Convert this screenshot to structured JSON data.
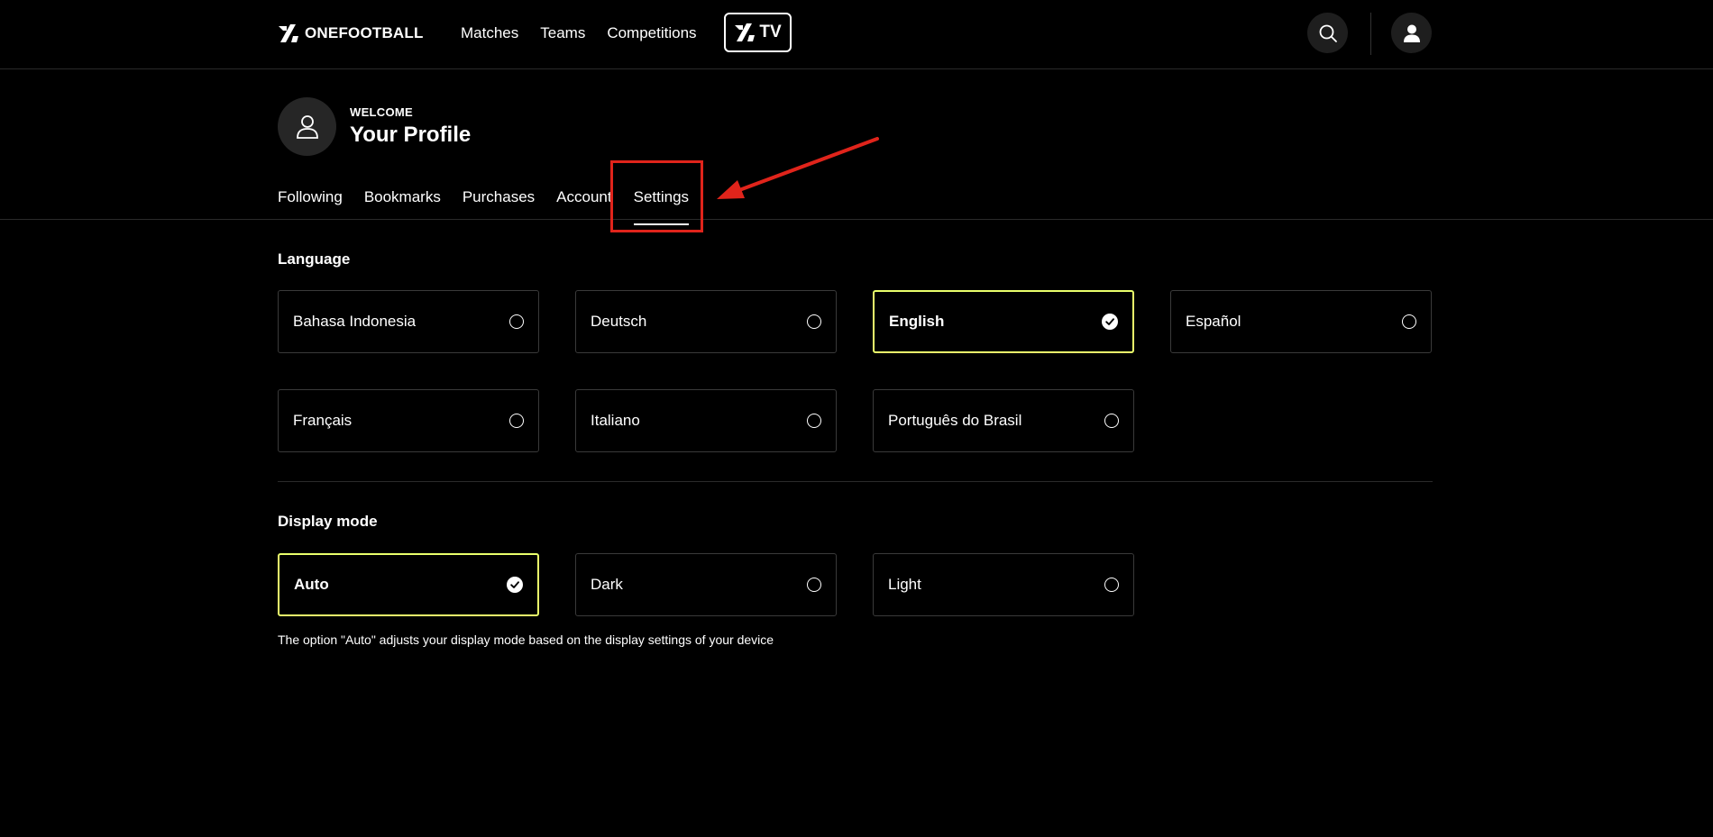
{
  "brand": {
    "name": "ONEFOOTBALL"
  },
  "nav": {
    "items": [
      {
        "label": "Matches"
      },
      {
        "label": "Teams"
      },
      {
        "label": "Competitions"
      }
    ],
    "tv_label": "TV"
  },
  "profile": {
    "welcome": "WELCOME",
    "title": "Your Profile"
  },
  "tabs": [
    {
      "label": "Following"
    },
    {
      "label": "Bookmarks"
    },
    {
      "label": "Purchases"
    },
    {
      "label": "Account"
    },
    {
      "label": "Settings",
      "active": true
    }
  ],
  "language": {
    "title": "Language",
    "options": [
      {
        "label": "Bahasa Indonesia",
        "selected": false
      },
      {
        "label": "Deutsch",
        "selected": false
      },
      {
        "label": "English",
        "selected": true
      },
      {
        "label": "Español",
        "selected": false
      },
      {
        "label": "Français",
        "selected": false
      },
      {
        "label": "Italiano",
        "selected": false
      },
      {
        "label": "Português do Brasil",
        "selected": false
      }
    ]
  },
  "display_mode": {
    "title": "Display mode",
    "options": [
      {
        "label": "Auto",
        "selected": true
      },
      {
        "label": "Dark",
        "selected": false
      },
      {
        "label": "Light",
        "selected": false
      }
    ],
    "note": "The option \"Auto\" adjusts your display mode based on the display settings of your device"
  },
  "colors": {
    "background": "#000000",
    "selected_border": "#eaff6b",
    "annotation": "#e0241b"
  },
  "icons": {
    "search": "search-icon",
    "user": "user-icon",
    "check": "check-icon",
    "radio": "radio-icon"
  }
}
